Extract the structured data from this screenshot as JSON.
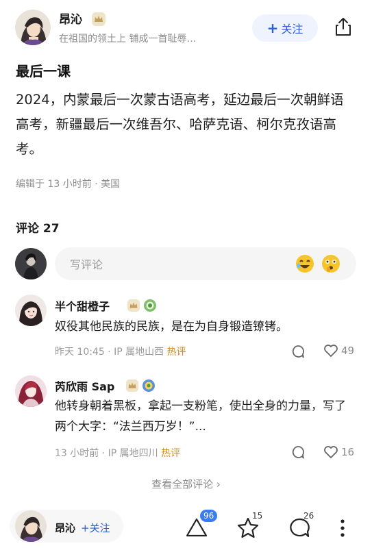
{
  "author": {
    "name": "昂沁",
    "signature": "在祖国的领土上  铺成一首耻辱…",
    "follow_label": "关注"
  },
  "post": {
    "title": "最后一课",
    "body": "2024，内蒙最后一次蒙古语高考，延边最后一次朝鲜语高考，新疆最后一次维吾尔、哈萨克语、柯尔克孜语高考。",
    "meta": "编辑于 13 小时前 · 美国"
  },
  "comments_section": {
    "header": "评论 27",
    "input_placeholder": "写评论"
  },
  "comments": [
    {
      "name": "半个甜橙子",
      "text": "奴役其他民族的民族，是在为自身锻造镣铐。",
      "time": "昨天 10:45 · IP 属地山西",
      "hot": "热评",
      "likes": "49"
    },
    {
      "name": "芮欣雨 Sap",
      "text": "他转身朝着黑板，拿起一支粉笔，使出全身的力量，写了两个大字：“法兰西万岁！”...",
      "time": "13 小时前 · IP 属地四川",
      "hot": "热评",
      "likes": "16"
    }
  ],
  "view_all": "查看全部评论 ›",
  "bottom_bar": {
    "name": "昂沁",
    "follow": "+关注",
    "upvote_count": "96",
    "favorite_count": "15",
    "comment_count": "26"
  },
  "colors": {
    "accent": "#2a5fd6",
    "hot": "#d48a12",
    "badge_blue": "#3b7cf0"
  }
}
